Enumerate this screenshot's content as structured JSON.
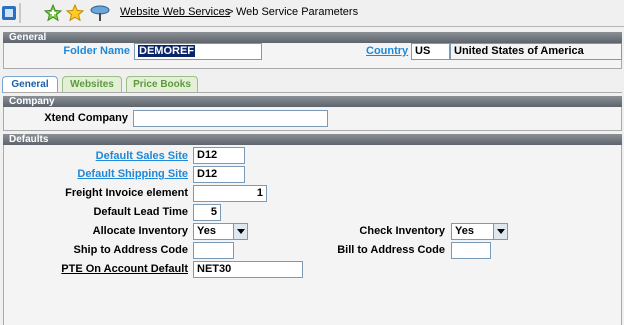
{
  "toolbar": {
    "breadcrumb_link": "Website Web Services",
    "breadcrumb_sep": ">",
    "breadcrumb_current": "Web Service Parameters",
    "icons": [
      "app-icon",
      "add-favorite-icon",
      "favorite-star-icon",
      "pin-icon"
    ]
  },
  "general": {
    "header": "General",
    "folder_label": "Folder Name",
    "folder_value": "DEMOREF",
    "country_label": "Country",
    "country_code": "US",
    "country_name": "United States of America"
  },
  "tabs": [
    {
      "label": "General",
      "active": true
    },
    {
      "label": "Websites",
      "active": false
    },
    {
      "label": "Price Books",
      "active": false
    }
  ],
  "company": {
    "header": "Company",
    "xtend_label": "Xtend Company",
    "xtend_value": ""
  },
  "defaults": {
    "header": "Defaults",
    "sales_site_label": "Default Sales Site",
    "sales_site_value": "D12",
    "shipping_site_label": "Default Shipping Site",
    "shipping_site_value": "D12",
    "freight_label": "Freight Invoice element",
    "freight_value": "1",
    "lead_time_label": "Default Lead Time",
    "lead_time_value": "5",
    "allocate_label": "Allocate Inventory",
    "allocate_value": "Yes",
    "check_label": "Check Inventory",
    "check_value": "Yes",
    "ship_addr_label": "Ship to Address Code",
    "ship_addr_value": "",
    "bill_addr_label": "Bill to Address Code",
    "bill_addr_value": "",
    "pte_label": "PTE On Account Default",
    "pte_value": "NET30"
  },
  "colors": {
    "link": "#1f88d8",
    "section_header": "#6b7178",
    "tab_inactive_text": "#5a9a3c",
    "tab_active_text": "#1a5fa8"
  }
}
